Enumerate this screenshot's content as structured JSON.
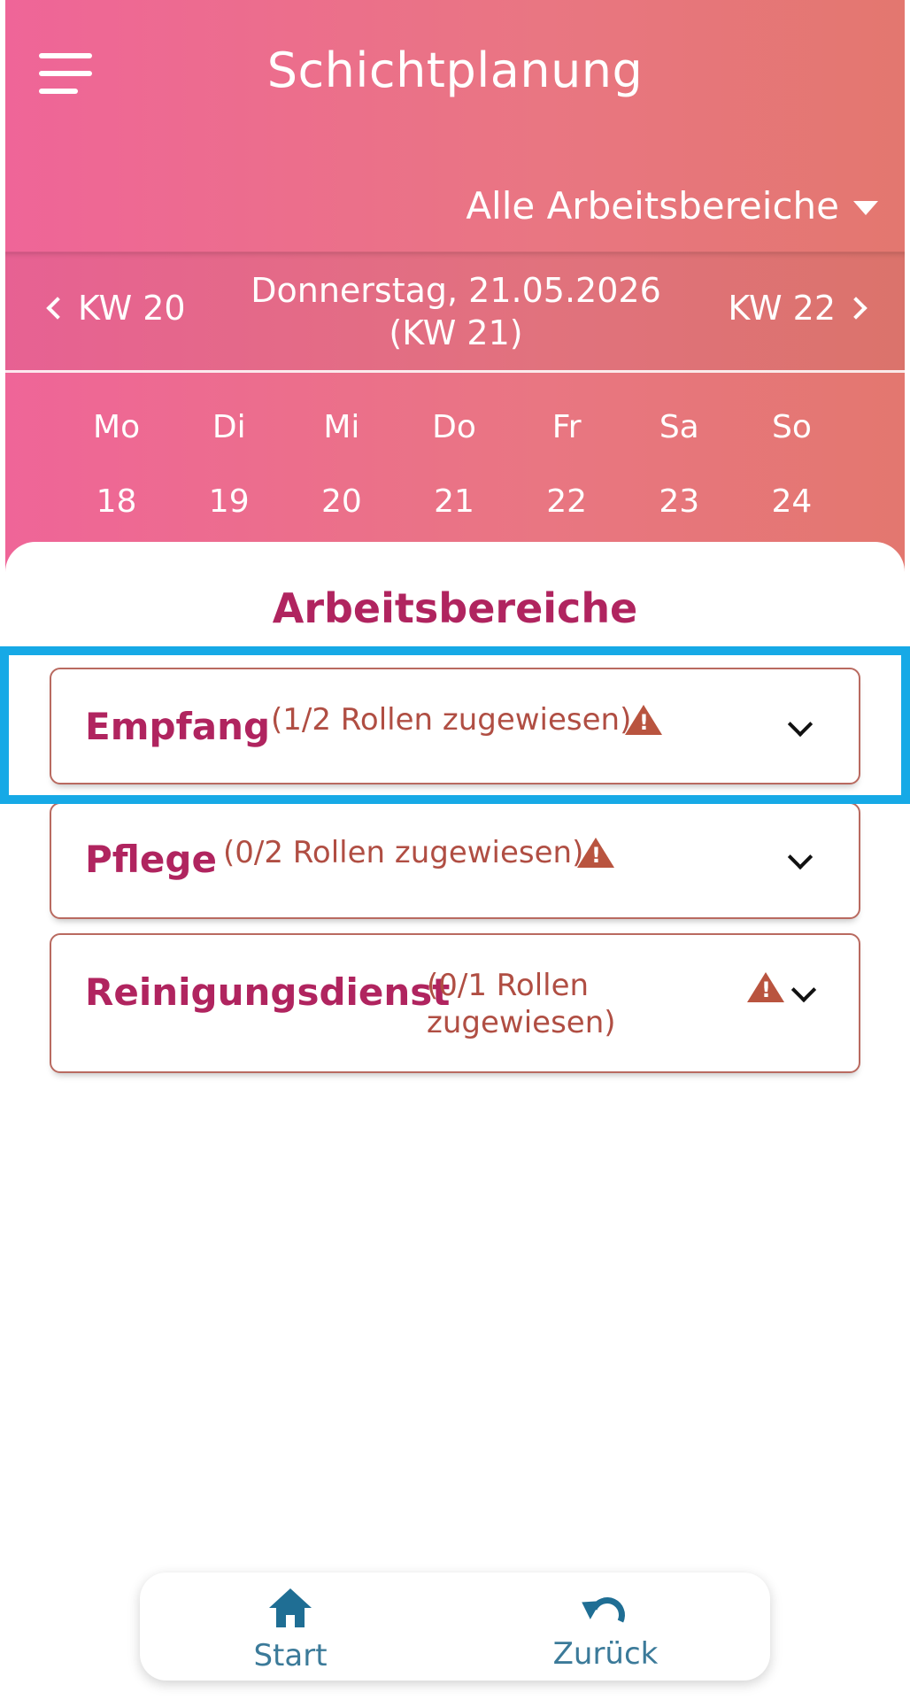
{
  "header": {
    "title": "Schichtplanung",
    "area_filter": "Alle Arbeitsbereiche"
  },
  "week_nav": {
    "prev": "KW 20",
    "current_date": "Donnerstag, 21.05.2026 (KW 21)",
    "next": "KW 22"
  },
  "calendar": {
    "days": [
      "Mo",
      "Di",
      "Mi",
      "Do",
      "Fr",
      "Sa",
      "So"
    ],
    "dates": [
      "18",
      "19",
      "20",
      "21",
      "22",
      "23",
      "24"
    ]
  },
  "areas": {
    "title": "Arbeitsbereiche",
    "items": [
      {
        "name": "Empfang",
        "status": "(1/2 Rollen zugewiesen)"
      },
      {
        "name": "Pflege",
        "status": "(0/2 Rollen zugewiesen)"
      },
      {
        "name": "Reinigungsdienst",
        "status": "(0/1 Rollen zugewiesen)"
      }
    ]
  },
  "bottom_nav": {
    "start": "Start",
    "back": "Zurück"
  },
  "colors": {
    "accent": "#b0245f",
    "warning": "#b9543f",
    "highlight": "#16a9e6",
    "nav_icon": "#1f6e94"
  }
}
